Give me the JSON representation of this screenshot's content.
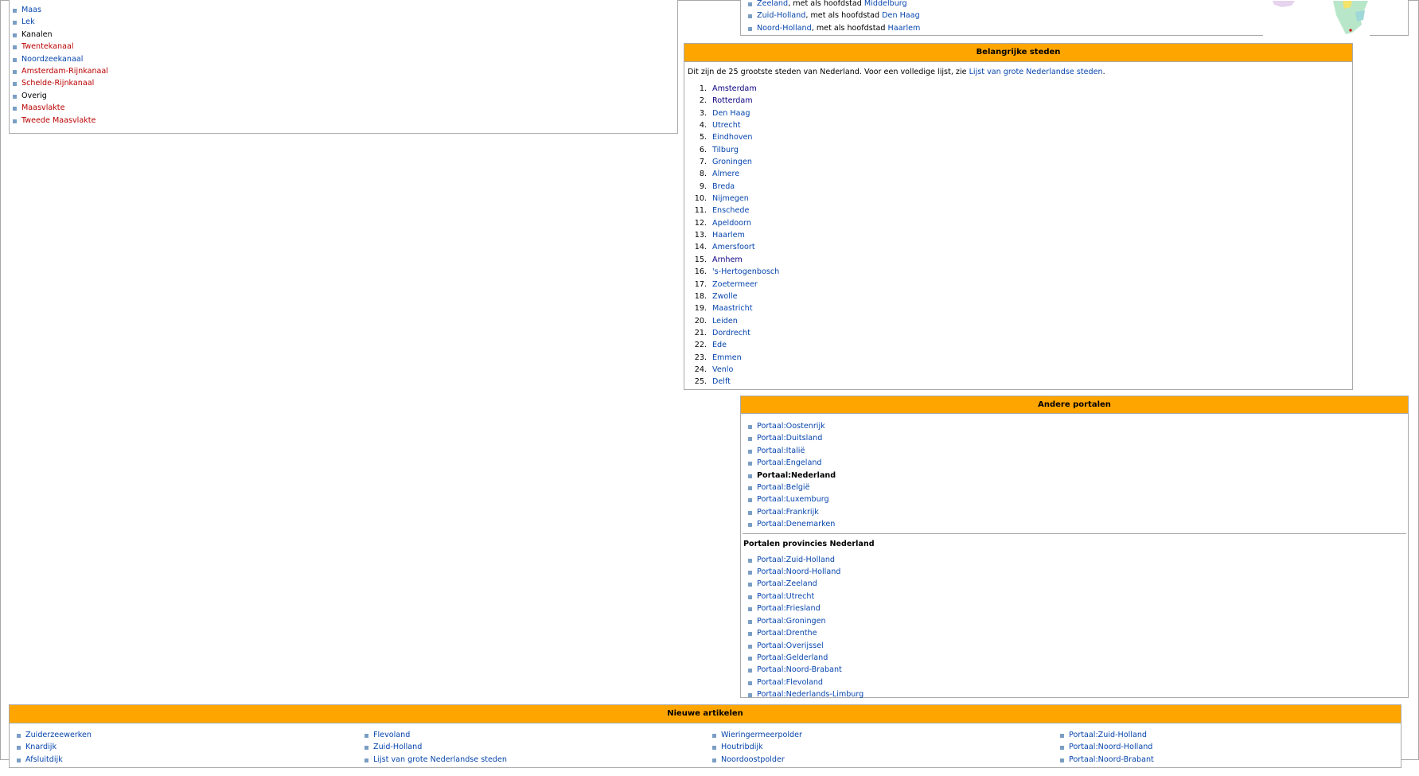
{
  "left_box": {
    "lead_items": [
      {
        "label": "Maas",
        "color": "blue"
      },
      {
        "label": "Lek",
        "color": "blue"
      }
    ],
    "categories": [
      {
        "label": "Kanalen",
        "items": [
          {
            "label": "Twentekanaal",
            "color": "red"
          },
          {
            "label": "Noordzeekanaal",
            "color": "blue"
          },
          {
            "label": "Amsterdam-Rijnkanaal",
            "color": "red"
          },
          {
            "label": "Schelde-Rijnkanaal",
            "color": "red"
          }
        ]
      },
      {
        "label": "Overig",
        "items": [
          {
            "label": "Maasvlakte",
            "color": "red"
          },
          {
            "label": "Tweede Maasvlakte",
            "color": "red"
          }
        ]
      }
    ]
  },
  "provinces_box": {
    "items": [
      {
        "prov": "Zeeland",
        "text": ", met als hoofdstad ",
        "capital": "Middelburg"
      },
      {
        "prov": "Zuid-Holland",
        "text": ", met als hoofdstad ",
        "capital": "Den Haag"
      },
      {
        "prov": "Noord-Holland",
        "text": ", met als hoofdstad ",
        "capital": "Haarlem"
      }
    ]
  },
  "cities_box": {
    "title": "Belangrijke steden",
    "intro_text": "Dit zijn de 25 grootste steden van Nederland. Voor een volledige lijst, zie ",
    "intro_link": "Lijst van grote Nederlandse steden",
    "intro_end": ".",
    "cities": [
      {
        "n": "1.",
        "name": "Amsterdam",
        "color": "visited"
      },
      {
        "n": "2.",
        "name": "Rotterdam",
        "color": "visited"
      },
      {
        "n": "3.",
        "name": "Den Haag",
        "color": "blue"
      },
      {
        "n": "4.",
        "name": "Utrecht",
        "color": "blue"
      },
      {
        "n": "5.",
        "name": "Eindhoven",
        "color": "blue"
      },
      {
        "n": "6.",
        "name": "Tilburg",
        "color": "blue"
      },
      {
        "n": "7.",
        "name": "Groningen",
        "color": "blue"
      },
      {
        "n": "8.",
        "name": "Almere",
        "color": "blue"
      },
      {
        "n": "9.",
        "name": "Breda",
        "color": "blue"
      },
      {
        "n": "10.",
        "name": "Nijmegen",
        "color": "blue"
      },
      {
        "n": "11.",
        "name": "Enschede",
        "color": "blue"
      },
      {
        "n": "12.",
        "name": "Apeldoorn",
        "color": "blue"
      },
      {
        "n": "13.",
        "name": "Haarlem",
        "color": "blue"
      },
      {
        "n": "14.",
        "name": "Amersfoort",
        "color": "blue"
      },
      {
        "n": "15.",
        "name": "Arnhem",
        "color": "visited"
      },
      {
        "n": "16.",
        "name": "'s-Hertogenbosch",
        "color": "blue"
      },
      {
        "n": "17.",
        "name": "Zoetermeer",
        "color": "blue"
      },
      {
        "n": "18.",
        "name": "Zwolle",
        "color": "blue"
      },
      {
        "n": "19.",
        "name": "Maastricht",
        "color": "blue"
      },
      {
        "n": "20.",
        "name": "Leiden",
        "color": "blue"
      },
      {
        "n": "21.",
        "name": "Dordrecht",
        "color": "blue"
      },
      {
        "n": "22.",
        "name": "Ede",
        "color": "blue"
      },
      {
        "n": "23.",
        "name": "Emmen",
        "color": "blue"
      },
      {
        "n": "24.",
        "name": "Venlo",
        "color": "blue"
      },
      {
        "n": "25.",
        "name": "Delft",
        "color": "blue"
      }
    ]
  },
  "portals_box": {
    "title": "Andere portalen",
    "portals": [
      {
        "label": "Portaal:Oostenrijk",
        "bold": false
      },
      {
        "label": "Portaal:Duitsland",
        "bold": false
      },
      {
        "label": "Portaal:Italië",
        "bold": false
      },
      {
        "label": "Portaal:Engeland",
        "bold": false
      },
      {
        "label": "Portaal:Nederland",
        "bold": true
      },
      {
        "label": "Portaal:België",
        "bold": false
      },
      {
        "label": "Portaal:Luxemburg",
        "bold": false
      },
      {
        "label": "Portaal:Frankrijk",
        "bold": false
      },
      {
        "label": "Portaal:Denemarken",
        "bold": false
      }
    ],
    "sub_title": "Portalen provincies Nederland",
    "province_portals": [
      "Portaal:Zuid-Holland",
      "Portaal:Noord-Holland",
      "Portaal:Zeeland",
      "Portaal:Utrecht",
      "Portaal:Friesland",
      "Portaal:Groningen",
      "Portaal:Drenthe",
      "Portaal:Overijssel",
      "Portaal:Gelderland",
      "Portaal:Noord-Brabant",
      "Portaal:Flevoland",
      "Portaal:Nederlands-Limburg"
    ]
  },
  "new_articles_box": {
    "title": "Nieuwe artikelen",
    "columns": [
      [
        "Zuiderzeewerken",
        "Knardijk",
        "Afsluitdijk"
      ],
      [
        "Flevoland",
        "Zuid-Holland",
        "Lijst van grote Nederlandse steden"
      ],
      [
        "Wieringermeerpolder",
        "Houtribdijk",
        "Noordoostpolder"
      ],
      [
        "Portaal:Zuid-Holland",
        "Portaal:Noord-Holland",
        "Portaal:Noord-Brabant"
      ]
    ]
  },
  "colors": {
    "header": "#ffa500",
    "link": "#0645ad",
    "redlink": "#ba0000",
    "visited": "#0b0080",
    "bullet": "#7a9ec4"
  }
}
